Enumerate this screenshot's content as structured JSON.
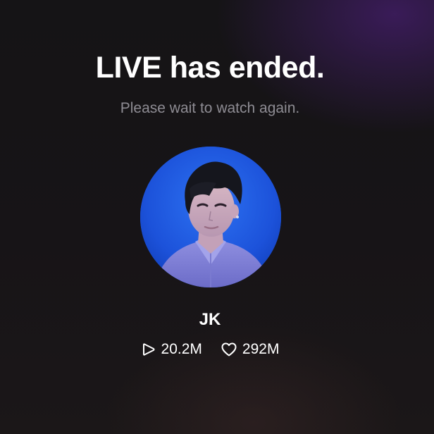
{
  "live_status": {
    "title": "LIVE has ended.",
    "subtitle": "Please wait to watch again."
  },
  "streamer": {
    "name": "JK",
    "avatar_icon": "profile-photo"
  },
  "stats": {
    "plays": {
      "icon": "play-icon",
      "value": "20.2M"
    },
    "likes": {
      "icon": "heart-icon",
      "value": "292M"
    }
  },
  "colors": {
    "text_primary": "#ffffff",
    "text_secondary": "#8e8c93",
    "avatar_background": "#1d55dd"
  }
}
